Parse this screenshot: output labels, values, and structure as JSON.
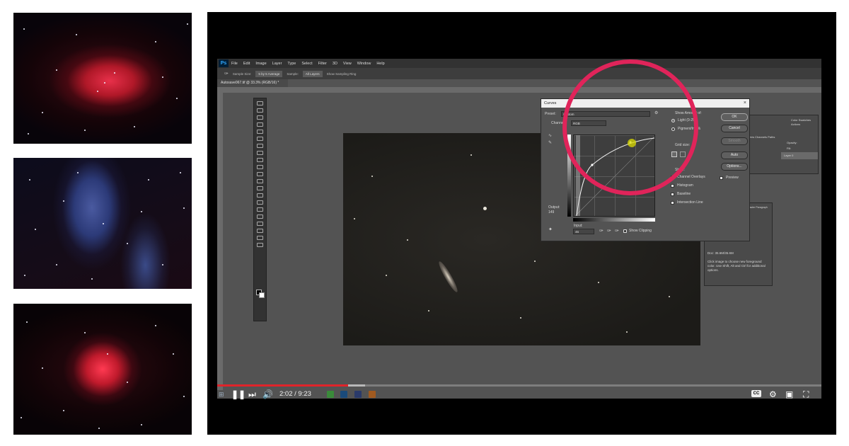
{
  "photoshop": {
    "app_logo": "Ps",
    "menu": [
      "File",
      "Edit",
      "Image",
      "Layer",
      "Type",
      "Select",
      "Filter",
      "3D",
      "View",
      "Window",
      "Help"
    ],
    "options": {
      "sample_size_label": "Sample Size:",
      "sample_size_value": "5 by 5 Average",
      "sample_label": "Sample:",
      "sample_value": "All Layers",
      "show_sampling_ring": "Show Sampling Ring"
    },
    "document_tab": "Autosave067.tif @ 33.3% (RGB/16) *",
    "info_panel": {
      "doc": "Doc: 35.6M/35.6M",
      "help_text": "Click image to choose new foreground color. Use Shift, Alt and Ctrl for additional options."
    },
    "panel_tabs": {
      "layers_tabs": "Layers  Channels  Paths",
      "opacity_label": "Opacity:",
      "fill_label": "Fill:",
      "layer_name": "Layer 0",
      "top_tabs": "Color  Swatches  Actions",
      "char_tabs": "Character  Paragraph"
    }
  },
  "curves": {
    "title": "Curves",
    "preset_label": "Preset:",
    "preset_value": "Custom",
    "channel_label": "Channel:",
    "channel_value": "RGB",
    "output_label": "Output:",
    "output_value": "149",
    "input_label": "Input:",
    "input_value": "46",
    "show_clipping": "Show Clipping",
    "show_amount_label": "Show Amount of:",
    "light_option": "Light  (0-255)",
    "pigment_option": "Pigment/Ink %",
    "grid_size_label": "Grid size:",
    "show_label": "Show:",
    "channel_overlays": "Channel Overlays",
    "histogram": "Histogram",
    "baseline": "Baseline",
    "intersection_line": "Intersection Line",
    "ok_button": "OK",
    "cancel_button": "Cancel",
    "smooth_button": "Smooth",
    "auto_button": "Auto",
    "options_button": "Options...",
    "preview_label": "Preview"
  },
  "video": {
    "time_display": "2:02 / 9:23",
    "progress_fraction": 0.217,
    "buffered_fraction": 0.245,
    "cc_label": "CC",
    "accent_color": "#e0242a"
  },
  "annotation": {
    "circle_color": "#e0245a"
  },
  "icons": [
    "play-pause-icon",
    "next-icon",
    "volume-icon",
    "settings-icon",
    "miniplayer-icon",
    "theater-icon",
    "fullscreen-icon"
  ]
}
